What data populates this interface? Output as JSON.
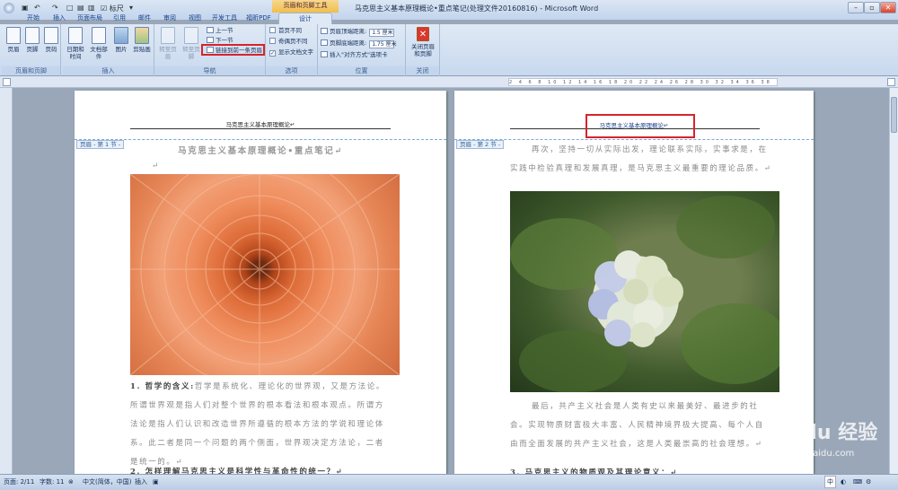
{
  "window": {
    "title": "马克思主义基本原理概论•重点笔记(处理文件20160816) - Microsoft Word",
    "context_tab_group": "页眉和页脚工具",
    "quick_access": {
      "ruler_label": "标尺"
    }
  },
  "tabs": [
    {
      "label": "开始"
    },
    {
      "label": "插入"
    },
    {
      "label": "页面布局"
    },
    {
      "label": "引用"
    },
    {
      "label": "邮件"
    },
    {
      "label": "审阅"
    },
    {
      "label": "视图"
    },
    {
      "label": "开发工具"
    },
    {
      "label": "福昕PDF"
    },
    {
      "label": "设计"
    }
  ],
  "ribbon": {
    "hf_group": {
      "label": "页眉和页脚",
      "header": "页眉",
      "footer": "页脚",
      "page_number": "页码"
    },
    "insert_group": {
      "label": "插入",
      "datetime": "日期和时间",
      "quickparts": "文档部件",
      "picture": "图片",
      "clipart": "剪贴画"
    },
    "nav_group": {
      "label": "导航",
      "goto_header": "转至页眉",
      "goto_footer": "转至页脚",
      "prev": "上一节",
      "next": "下一节",
      "link_prev": "链接到前一条页眉"
    },
    "options_group": {
      "label": "选项",
      "diff_first": "首页不同",
      "diff_oddeven": "奇偶页不同",
      "show_text": "显示文档文字"
    },
    "position_group": {
      "label": "位置",
      "header_dist_label": "页眉顶端距离:",
      "header_dist": "1.5 厘米",
      "footer_dist_label": "页脚底端距离:",
      "footer_dist": "1.75 厘米",
      "align_tab": "插入\"对齐方式\"选项卡"
    },
    "close_group": {
      "label": "关闭",
      "close": "关闭页眉和页脚"
    }
  },
  "page1": {
    "header_text": "马克思主义基本原理概论↵",
    "header_tag": "页眉 - 第 1 节 -",
    "title": "马克思主义基本原理概论•重点笔记↵",
    "para1_head": "1. 哲学的含义:",
    "para1": "哲学是系统化、理论化的世界观，又是方法论。所谓世界观是指人们对整个世界的根本看法和根本观点。所谓方法论是指人们认识和改造世界所遵循的根本方法的学说和理论体系。此二者是同一个问题的两个侧面，世界观决定方法论，二者是统一的。↵",
    "para2_head": "2. 怎样理解马克思主义是科学性与革命性的统一？↵"
  },
  "page2": {
    "header_text": "马克思主义基本原理概论↵",
    "header_tag": "页眉 - 第 2 节 -",
    "para1": "再次，坚持一切从实际出发，理论联系实际，实事求是，在实践中检验真理和发展真理，是马克思主义最重要的理论品质。↵",
    "para2": "最后，共产主义社会是人类有史以来最美好、最进步的社会。实现物质财富极大丰富、人民精神境界极大提高、每个人自由而全面发展的共产主义社会，这是人类最崇高的社会理想。↵",
    "para3": "3. 马克思主义的物质观及其理论意义：↵"
  },
  "status": {
    "page": "页面: 2/11",
    "words": "字数: 11",
    "language": "中文(简体，中国)",
    "mode": "插入"
  },
  "watermark": {
    "brand": "Baidu 经验",
    "url": "jingyan.baidu.com"
  },
  "ruler_marks": "2 4 6 8 10 12 14 16 18 20 22 24 26 28 30 32 34 36 38",
  "tray": {
    "ime": "中"
  }
}
